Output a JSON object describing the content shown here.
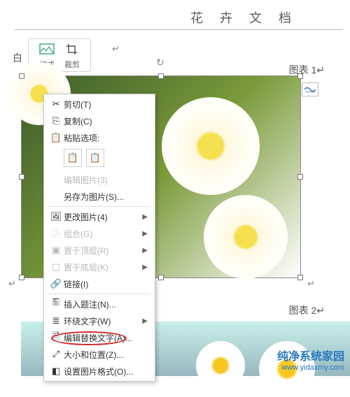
{
  "document": {
    "title": "花卉文档"
  },
  "ribbon": {
    "left_label": "白",
    "style_label": "样式",
    "crop_label": "裁剪"
  },
  "captions": {
    "caption1_prefix": "图表",
    "caption1_num": "1",
    "caption2_prefix": "图表",
    "caption2_num": "2"
  },
  "context_menu": {
    "cut": "剪切(T)",
    "copy": "复制(C)",
    "paste_options": "粘贴选项:",
    "edit_picture": "编辑图片(3)",
    "save_as_picture": "另存为图片(S)...",
    "change_picture": "更改图片(4)",
    "group": "组合(G)",
    "bring_front": "置于顶层(R)",
    "send_back": "置于底层(K)",
    "link": "链接(I)",
    "insert_caption": "插入题注(N)...",
    "wrap_text": "环绕文字(W)",
    "edit_alt_text": "编辑替换文字(A)...",
    "size_position": "大小和位置(Z)...",
    "format_picture": "设置图片格式(O)..."
  },
  "watermark": {
    "title": "纯净系统家园",
    "url": "www.yidaxmy.com"
  }
}
